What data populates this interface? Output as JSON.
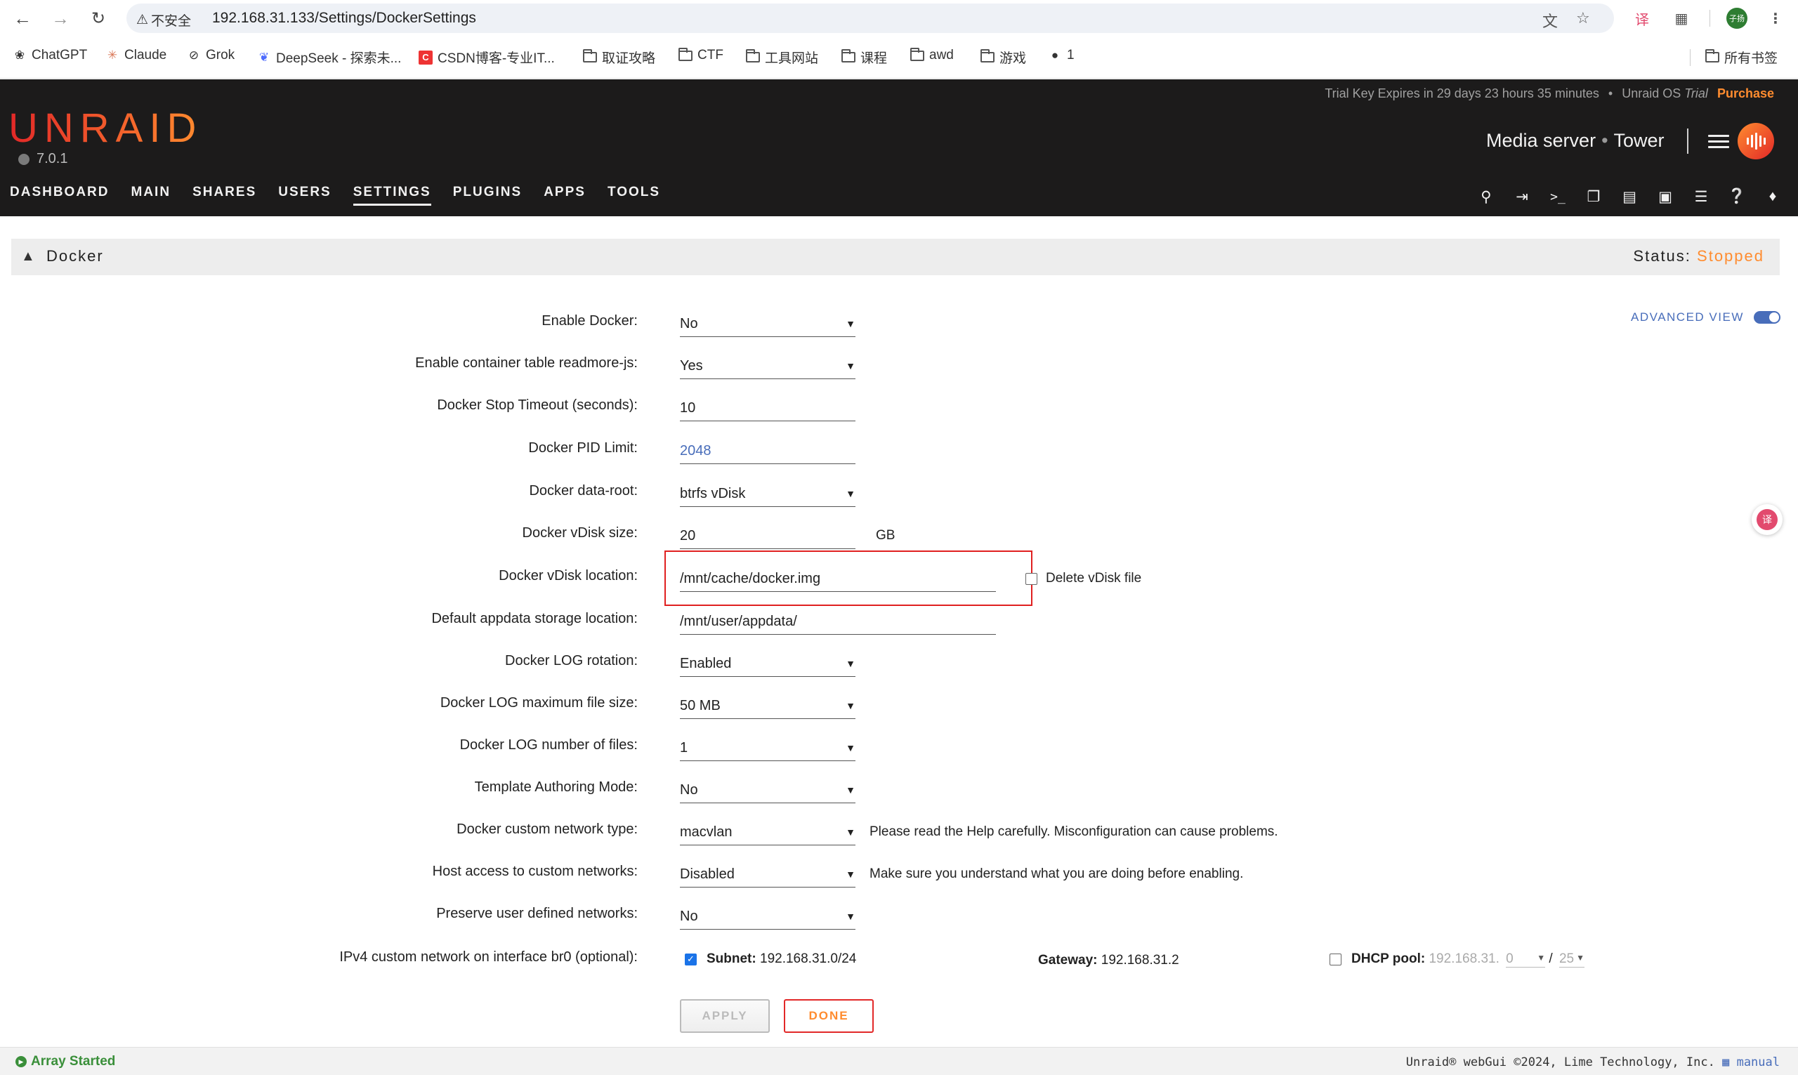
{
  "browser": {
    "security_label": "不安全",
    "url": "192.168.31.133/Settings/DockerSettings",
    "profile_label": "子扬",
    "bookmarks": [
      {
        "label": "ChatGPT",
        "icon": "chatgpt-icon"
      },
      {
        "label": "Claude",
        "icon": "claude-icon"
      },
      {
        "label": "Grok",
        "icon": "grok-icon"
      },
      {
        "label": "DeepSeek - 探索未...",
        "icon": "deepseek-icon"
      },
      {
        "label": "CSDN博客-专业IT...",
        "icon": "csdn-icon"
      },
      {
        "label": "取证攻略",
        "icon": "folder-icon"
      },
      {
        "label": "CTF",
        "icon": "folder-icon"
      },
      {
        "label": "工具网站",
        "icon": "folder-icon"
      },
      {
        "label": "课程",
        "icon": "folder-icon"
      },
      {
        "label": "awd",
        "icon": "folder-icon"
      },
      {
        "label": "游戏",
        "icon": "folder-icon"
      },
      {
        "label": "1",
        "icon": "globe-icon"
      }
    ],
    "all_bookmarks": "所有书签"
  },
  "header": {
    "trial_text": "Trial Key Expires in 29 days 23 hours 35 minutes",
    "os_label": "Unraid OS",
    "os_trial": "Trial",
    "purchase": "Purchase",
    "logo": "UNRAID",
    "version": "7.0.1",
    "server_description": "Media server",
    "server_name": "Tower",
    "nav": [
      "DASHBOARD",
      "MAIN",
      "SHARES",
      "USERS",
      "SETTINGS",
      "PLUGINS",
      "APPS",
      "TOOLS"
    ],
    "active_nav": "SETTINGS",
    "icons": [
      "search-icon",
      "logout-icon",
      "terminal-icon",
      "copy-icon",
      "feedback-icon",
      "monitor-icon",
      "log-icon",
      "help-icon",
      "bell-icon"
    ]
  },
  "page": {
    "title": "Docker",
    "status_label": "Status:",
    "status_value": "Stopped",
    "advanced_view": "ADVANCED VIEW"
  },
  "settings": {
    "enable_docker": {
      "label": "Enable Docker:",
      "value": "No"
    },
    "readmore": {
      "label": "Enable container table readmore-js:",
      "value": "Yes"
    },
    "stop_timeout": {
      "label": "Docker Stop Timeout (seconds):",
      "value": "10"
    },
    "pid_limit": {
      "label": "Docker PID Limit:",
      "value": "2048"
    },
    "data_root": {
      "label": "Docker data-root:",
      "value": "btrfs vDisk"
    },
    "vdisk_size": {
      "label": "Docker vDisk size:",
      "value": "20",
      "unit": "GB"
    },
    "vdisk_location": {
      "label": "Docker vDisk location:",
      "value": "/mnt/cache/docker.img",
      "delete_label": "Delete vDisk file"
    },
    "appdata": {
      "label": "Default appdata storage location:",
      "value": "/mnt/user/appdata/"
    },
    "log_rotation": {
      "label": "Docker LOG rotation:",
      "value": "Enabled"
    },
    "log_max_size": {
      "label": "Docker LOG maximum file size:",
      "value": "50 MB"
    },
    "log_files": {
      "label": "Docker LOG number of files:",
      "value": "1"
    },
    "template_mode": {
      "label": "Template Authoring Mode:",
      "value": "No"
    },
    "network_type": {
      "label": "Docker custom network type:",
      "value": "macvlan",
      "note": "Please read the Help carefully. Misconfiguration can cause problems."
    },
    "host_access": {
      "label": "Host access to custom networks:",
      "value": "Disabled",
      "note": "Make sure you understand what you are doing before enabling."
    },
    "preserve_networks": {
      "label": "Preserve user defined networks:",
      "value": "No"
    },
    "ipv4": {
      "label": "IPv4 custom network on interface br0 (optional):",
      "subnet_label": "Subnet:",
      "subnet_value": "192.168.31.0/24",
      "subnet_checked": true,
      "gateway_label": "Gateway:",
      "gateway_value": "192.168.31.2",
      "dhcp_label": "DHCP pool:",
      "dhcp_prefix": "192.168.31.",
      "dhcp_start": "0",
      "dhcp_separator": "/",
      "dhcp_size": "25",
      "dhcp_checked": false
    }
  },
  "buttons": {
    "apply": "APPLY",
    "done": "DONE"
  },
  "footer": {
    "array_status": "Array Started",
    "copyright": "Unraid® webGui ©2024, Lime Technology, Inc.",
    "manual": "manual"
  },
  "colors": {
    "accent": "#ff8c2f",
    "brand_red": "#e22828",
    "link": "#486dba",
    "header_bg": "#1c1b1b",
    "highlight": "#e02020"
  }
}
